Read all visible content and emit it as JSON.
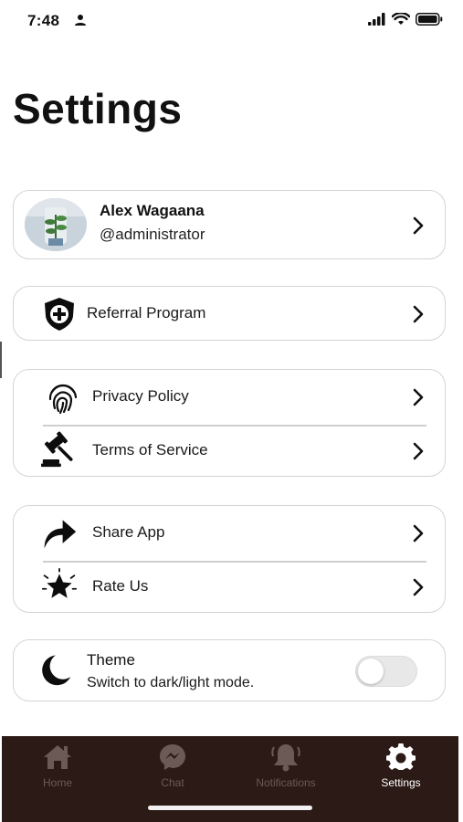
{
  "status_bar": {
    "time": "7:48",
    "icons": [
      "person-icon",
      "signal-icon",
      "wifi-icon",
      "battery-icon"
    ]
  },
  "page": {
    "title": "Settings"
  },
  "profile": {
    "name": "Alex Wagaana",
    "handle": "@administrator"
  },
  "menu": {
    "referral": {
      "label": "Referral Program",
      "icon": "shield-plus-icon"
    },
    "privacy": {
      "label": "Privacy Policy",
      "icon": "fingerprint-icon"
    },
    "terms": {
      "label": "Terms of Service",
      "icon": "gavel-icon"
    },
    "share": {
      "label": "Share App",
      "icon": "share-arrow-icon"
    },
    "rate": {
      "label": "Rate Us",
      "icon": "star-icon"
    }
  },
  "theme": {
    "title": "Theme",
    "subtitle": "Switch to dark/light mode.",
    "dark_mode_on": false,
    "icon": "moon-icon"
  },
  "tab_bar": {
    "tabs": [
      {
        "label": "Home",
        "icon": "home-icon",
        "active": false
      },
      {
        "label": "Chat",
        "icon": "chat-icon",
        "active": false
      },
      {
        "label": "Notifications",
        "icon": "bell-icon",
        "active": false
      },
      {
        "label": "Settings",
        "icon": "gear-icon",
        "active": true
      }
    ]
  },
  "colors": {
    "tab_bar_bg": "#2b1a15",
    "tab_inactive": "#6b5a55",
    "tab_active": "#ffffff",
    "card_border": "#d4d4d4"
  }
}
